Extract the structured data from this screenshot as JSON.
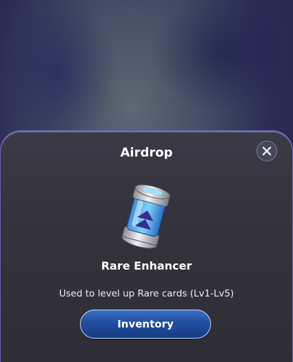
{
  "modal": {
    "title": "Airdrop",
    "close_icon": "close-icon",
    "item": {
      "icon": "rare-enhancer-icon",
      "name": "Rare Enhancer",
      "description": "Used to level up Rare cards (Lv1-Lv5)"
    },
    "button_label": "Inventory"
  },
  "colors": {
    "button": "#1f4e9e",
    "panel": "#34333b",
    "border": "#6d62b6"
  }
}
